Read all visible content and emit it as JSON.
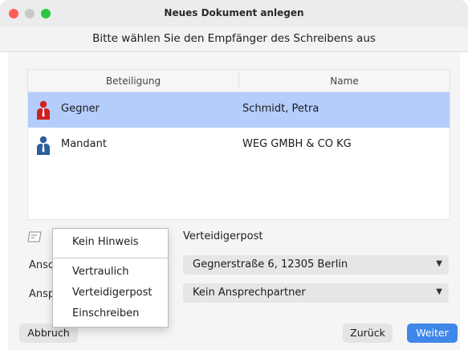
{
  "window": {
    "title": "Neues Dokument anlegen"
  },
  "dialog": {
    "prompt": "Bitte wählen Sie den Empfänger des Schreibens aus"
  },
  "table": {
    "columns": [
      "Beteiligung",
      "Name"
    ],
    "rows": [
      {
        "role": "Gegner",
        "name": "Schmidt, Petra",
        "icon": "person-red-icon",
        "selected": true
      },
      {
        "role": "Mandant",
        "name": "WEG GMBH & CO KG",
        "icon": "person-blue-icon",
        "selected": false
      }
    ]
  },
  "colors": {
    "selected_row": "#b4cdfb",
    "primary_button": "#3f87e8",
    "opponent_icon": "#d11f1f",
    "client_icon": "#2b5f9e"
  },
  "form": {
    "hint_value": "Verteidigerpost",
    "address_label": "Ansc",
    "address_value": "Gegnerstraße 6, 12305 Berlin",
    "contact_label": "Ansp",
    "contact_value": "Kein Ansprechpartner"
  },
  "popup": {
    "items": [
      "Kein Hinweis",
      "Vertraulich",
      "Verteidigerpost",
      "Einschreiben"
    ]
  },
  "buttons": {
    "cancel": "Abbruch",
    "back": "Zurück",
    "next": "Weiter"
  }
}
